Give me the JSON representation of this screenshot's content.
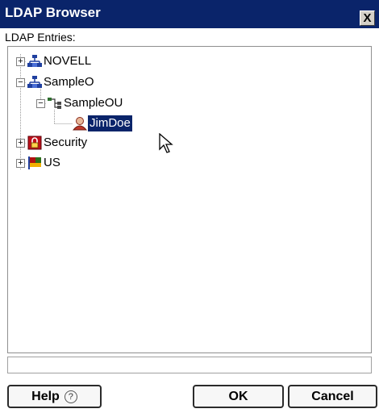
{
  "window": {
    "title": "LDAP Browser",
    "close_label": "X"
  },
  "panel": {
    "label": "LDAP Entries:"
  },
  "tree": {
    "nodes": [
      {
        "label": "NOVELL",
        "expander": "+",
        "icon": "organization-icon",
        "selected": false
      },
      {
        "label": "SampleO",
        "expander": "−",
        "icon": "organization-icon",
        "selected": false
      },
      {
        "label": "SampleOU",
        "expander": "−",
        "icon": "organizational-unit-icon",
        "selected": false
      },
      {
        "label": "JimDoe",
        "expander": "",
        "icon": "user-icon",
        "selected": true
      },
      {
        "label": "Security",
        "expander": "+",
        "icon": "security-container-icon",
        "selected": false
      },
      {
        "label": "US",
        "expander": "+",
        "icon": "country-icon",
        "selected": false
      }
    ]
  },
  "buttons": {
    "help_label": "Help",
    "help_icon": "?",
    "ok_label": "OK",
    "cancel_label": "Cancel"
  },
  "colors": {
    "titlebar": "#0a246a",
    "selection": "#0a246a"
  }
}
